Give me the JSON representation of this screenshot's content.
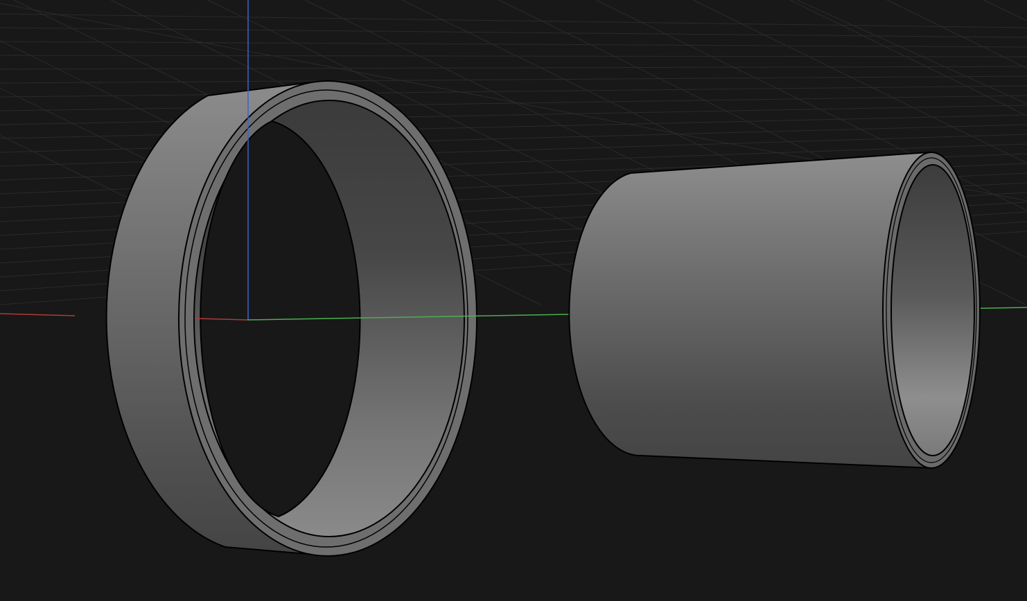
{
  "viewport": {
    "background_color": "#181818",
    "grid_color": "#2b2b2b",
    "axes": {
      "x_color": "#b03a3a",
      "y_color": "#4caf50",
      "z_color": "#3f63c8"
    },
    "show_grid": true
  },
  "scene_objects": [
    {
      "kind": "ring",
      "color": "#8a8a8a"
    },
    {
      "kind": "tube",
      "color": "#8a8a8a"
    }
  ],
  "icons": {
    "origin_gizmo": "axis-gizmo-icon"
  }
}
